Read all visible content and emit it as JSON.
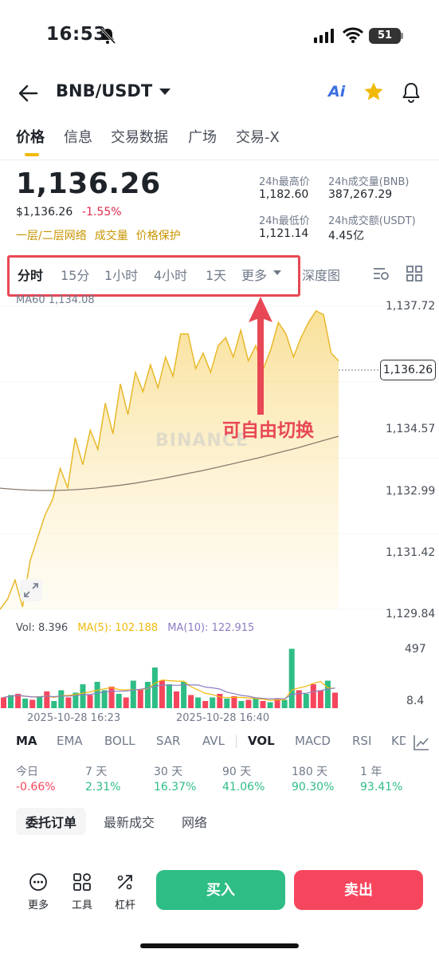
{
  "status_bar": {
    "time": "16:53",
    "battery": "51"
  },
  "header": {
    "pair": "BNB/USDT",
    "ai_label": "Ai"
  },
  "tabs": [
    "价格",
    "信息",
    "交易数据",
    "广场",
    "交易-X"
  ],
  "price": {
    "last": "1,136.26",
    "usd": "$1,136.26",
    "change": "-1.55%"
  },
  "tags": [
    "一层/二层网络",
    "成交量",
    "价格保护"
  ],
  "stats": {
    "high_label": "24h最高价",
    "high": "1,182.60",
    "vol_bnb_label": "24h成交量(BNB)",
    "vol_bnb": "387,267.29",
    "low_label": "24h最低价",
    "low": "1,121.14",
    "vol_usdt_label": "24h成交额(USDT)",
    "vol_usdt": "4.45亿"
  },
  "timeframes": [
    "分时",
    "15分",
    "1小时",
    "4小时",
    "1天",
    "更多",
    "深度图"
  ],
  "chart_data": {
    "type": "area",
    "ma60_label": "MA60 1,134.08",
    "y_ticks": [
      "1,137.72",
      "1,134.57",
      "1,132.99",
      "1,131.42",
      "1,129.84"
    ],
    "current_price": "1,136.26",
    "x_ticks": [
      "2025-10-28 16:23",
      "2025-10-28 16:40"
    ],
    "ylim": [
      1129.84,
      1137.72
    ],
    "price": [
      1129.84,
      1130.1,
      1130.6,
      1129.9,
      1131.1,
      1131.7,
      1132.3,
      1132.7,
      1133.5,
      1133.0,
      1134.3,
      1133.6,
      1134.5,
      1134.0,
      1135.2,
      1134.4,
      1135.7,
      1134.9,
      1136.0,
      1135.5,
      1136.2,
      1135.6,
      1136.4,
      1135.9,
      1137.0,
      1137.0,
      1136.1,
      1136.5,
      1136.0,
      1136.7,
      1136.9,
      1136.4,
      1137.1,
      1136.3,
      1136.7,
      1136.1,
      1136.6,
      1137.3,
      1137.0,
      1136.4,
      1136.9,
      1137.3,
      1137.6,
      1137.5,
      1136.5,
      1136.3
    ],
    "ma60": [
      1132.99,
      1132.96,
      1132.94,
      1132.93,
      1132.93,
      1132.94,
      1132.96,
      1132.99,
      1133.03,
      1133.07,
      1133.12,
      1133.18,
      1133.24,
      1133.31,
      1133.38,
      1133.45,
      1133.53,
      1133.61,
      1133.69,
      1133.77,
      1133.86,
      1133.95,
      1134.04,
      1134.14,
      1134.24,
      1134.34
    ],
    "volume": {
      "label": "Vol: 8.396",
      "ma5_label": "MA(5): 102.188",
      "ma10_label": "MA(10): 122.915",
      "y_ticks": [
        "497",
        "8.4"
      ],
      "ylim": [
        0,
        560
      ],
      "bars": [
        {
          "v": 90,
          "up": false
        },
        {
          "v": 110,
          "up": true
        },
        {
          "v": 120,
          "up": false
        },
        {
          "v": 80,
          "up": true
        },
        {
          "v": 70,
          "up": false
        },
        {
          "v": 100,
          "up": true
        },
        {
          "v": 140,
          "up": false
        },
        {
          "v": 60,
          "up": true
        },
        {
          "v": 150,
          "up": true
        },
        {
          "v": 90,
          "up": false
        },
        {
          "v": 130,
          "up": true
        },
        {
          "v": 200,
          "up": true
        },
        {
          "v": 110,
          "up": false
        },
        {
          "v": 220,
          "up": true
        },
        {
          "v": 150,
          "up": true
        },
        {
          "v": 180,
          "up": false
        },
        {
          "v": 120,
          "up": true
        },
        {
          "v": 90,
          "up": false
        },
        {
          "v": 230,
          "up": true
        },
        {
          "v": 160,
          "up": false
        },
        {
          "v": 220,
          "up": true
        },
        {
          "v": 340,
          "up": true
        },
        {
          "v": 230,
          "up": false
        },
        {
          "v": 200,
          "up": true
        },
        {
          "v": 140,
          "up": false
        },
        {
          "v": 220,
          "up": true
        },
        {
          "v": 110,
          "up": false
        },
        {
          "v": 90,
          "up": true
        },
        {
          "v": 60,
          "up": false
        },
        {
          "v": 90,
          "up": true
        },
        {
          "v": 120,
          "up": false
        },
        {
          "v": 80,
          "up": true
        },
        {
          "v": 100,
          "up": false
        },
        {
          "v": 60,
          "up": true
        },
        {
          "v": 70,
          "up": false
        },
        {
          "v": 90,
          "up": true
        },
        {
          "v": 60,
          "up": false
        },
        {
          "v": 50,
          "up": true
        },
        {
          "v": 80,
          "up": false
        },
        {
          "v": 70,
          "up": true
        },
        {
          "v": 497,
          "up": true
        },
        {
          "v": 150,
          "up": false
        },
        {
          "v": 120,
          "up": true
        },
        {
          "v": 200,
          "up": false
        },
        {
          "v": 150,
          "up": false
        },
        {
          "v": 230,
          "up": true
        },
        {
          "v": 130,
          "up": false
        }
      ]
    }
  },
  "annotation": "可自由切换",
  "watermark": "BINANCE",
  "indicators": [
    "MA",
    "EMA",
    "BOLL",
    "SAR",
    "AVL",
    "VOL",
    "MACD",
    "RSI",
    "KD"
  ],
  "performance": [
    {
      "label": "今日",
      "value": "-0.66%"
    },
    {
      "label": "7 天",
      "value": "2.31%"
    },
    {
      "label": "30 天",
      "value": "16.37%"
    },
    {
      "label": "90 天",
      "value": "41.06%"
    },
    {
      "label": "180 天",
      "value": "90.30%"
    },
    {
      "label": "1 年",
      "value": "93.41%"
    }
  ],
  "order_tabs": [
    "委托订单",
    "最新成交",
    "网络"
  ],
  "bottom": {
    "more": "更多",
    "tools": "工具",
    "leverage": "杠杆",
    "buy": "买入",
    "sell": "卖出"
  },
  "colors": {
    "up": "#2ebd85",
    "down": "#f6465d",
    "accent": "#f0b90b",
    "annotation": "#e84855"
  }
}
